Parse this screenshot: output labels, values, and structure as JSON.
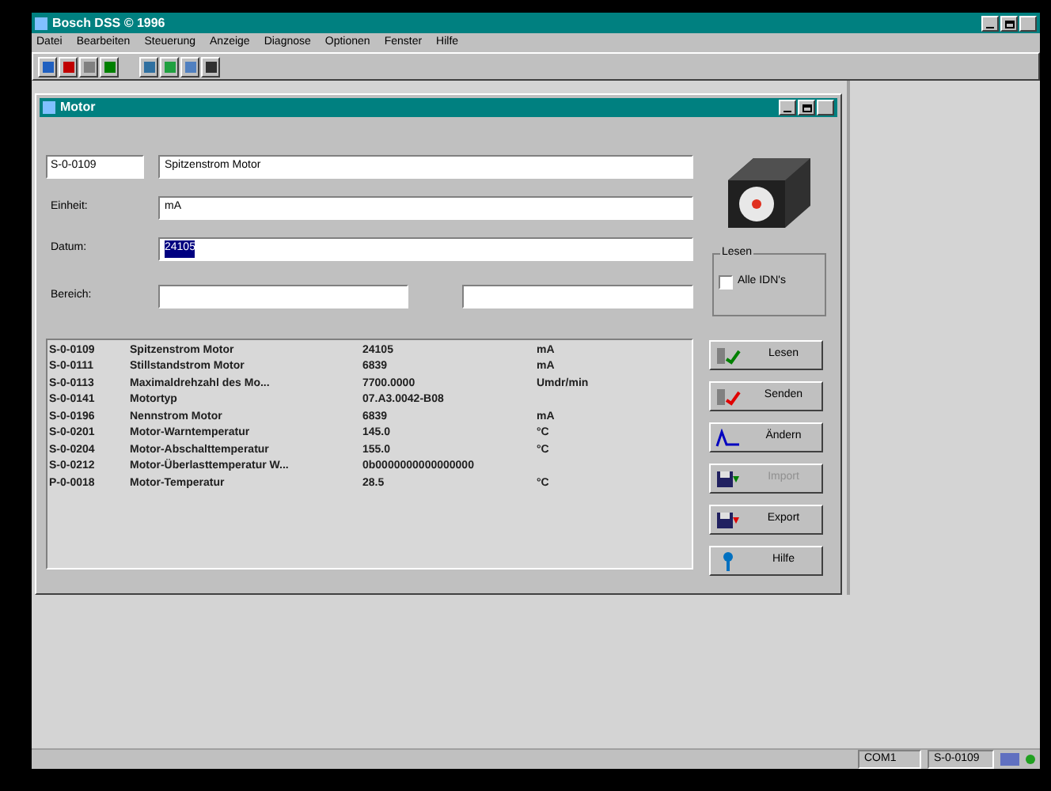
{
  "window": {
    "title": "Bosch DSS © 1996"
  },
  "menu": [
    "Datei",
    "Bearbeiten",
    "Steuerung",
    "Anzeige",
    "Diagnose",
    "Optionen",
    "Fenster",
    "Hilfe"
  ],
  "child": {
    "title": "Motor",
    "idn": "S-0-0109",
    "name": "Spitzenstrom Motor",
    "fields": [
      {
        "label": "Einheit:",
        "value": "mA",
        "selected": false
      },
      {
        "label": "Datum:",
        "value": "24105",
        "selected": true
      }
    ],
    "range_label": "Bereich:",
    "group": {
      "title": "Lesen",
      "checkbox": {
        "label": "Alle IDN's",
        "checked": false
      }
    },
    "rows": [
      {
        "idn": "S-0-0109",
        "name": "Spitzenstrom Motor",
        "value": "24105",
        "unit": "mA"
      },
      {
        "idn": "S-0-0111",
        "name": "Stillstandstrom Motor",
        "value": "6839",
        "unit": "mA"
      },
      {
        "idn": "S-0-0113",
        "name": "Maximaldrehzahl des Mo...",
        "value": "7700.0000",
        "unit": "Umdr/min"
      },
      {
        "idn": "S-0-0141",
        "name": "Motortyp",
        "value": "07.A3.0042-B08",
        "unit": ""
      },
      {
        "idn": "S-0-0196",
        "name": "Nennstrom Motor",
        "value": "6839",
        "unit": "mA"
      },
      {
        "idn": "S-0-0201",
        "name": "Motor-Warntemperatur",
        "value": "145.0",
        "unit": "°C"
      },
      {
        "idn": "S-0-0204",
        "name": "Motor-Abschalttemperatur",
        "value": "155.0",
        "unit": "°C"
      },
      {
        "idn": "S-0-0212",
        "name": "Motor-Überlasttemperatur W...",
        "value": "0b0000000000000000",
        "unit": ""
      },
      {
        "idn": "P-0-0018",
        "name": "Motor-Temperatur",
        "value": "28.5",
        "unit": "°C"
      }
    ],
    "buttons": [
      {
        "label": "Lesen",
        "kind": "read",
        "disabled": false
      },
      {
        "label": "Senden",
        "kind": "send",
        "disabled": false
      },
      {
        "label": "Ändern",
        "kind": "edit",
        "disabled": false
      },
      {
        "label": "Import",
        "kind": "import",
        "disabled": true
      },
      {
        "label": "Export",
        "kind": "export",
        "disabled": false
      },
      {
        "label": "Hilfe",
        "kind": "help",
        "disabled": false
      }
    ]
  },
  "status_bar": [
    "COM1",
    "S-0-0109"
  ]
}
